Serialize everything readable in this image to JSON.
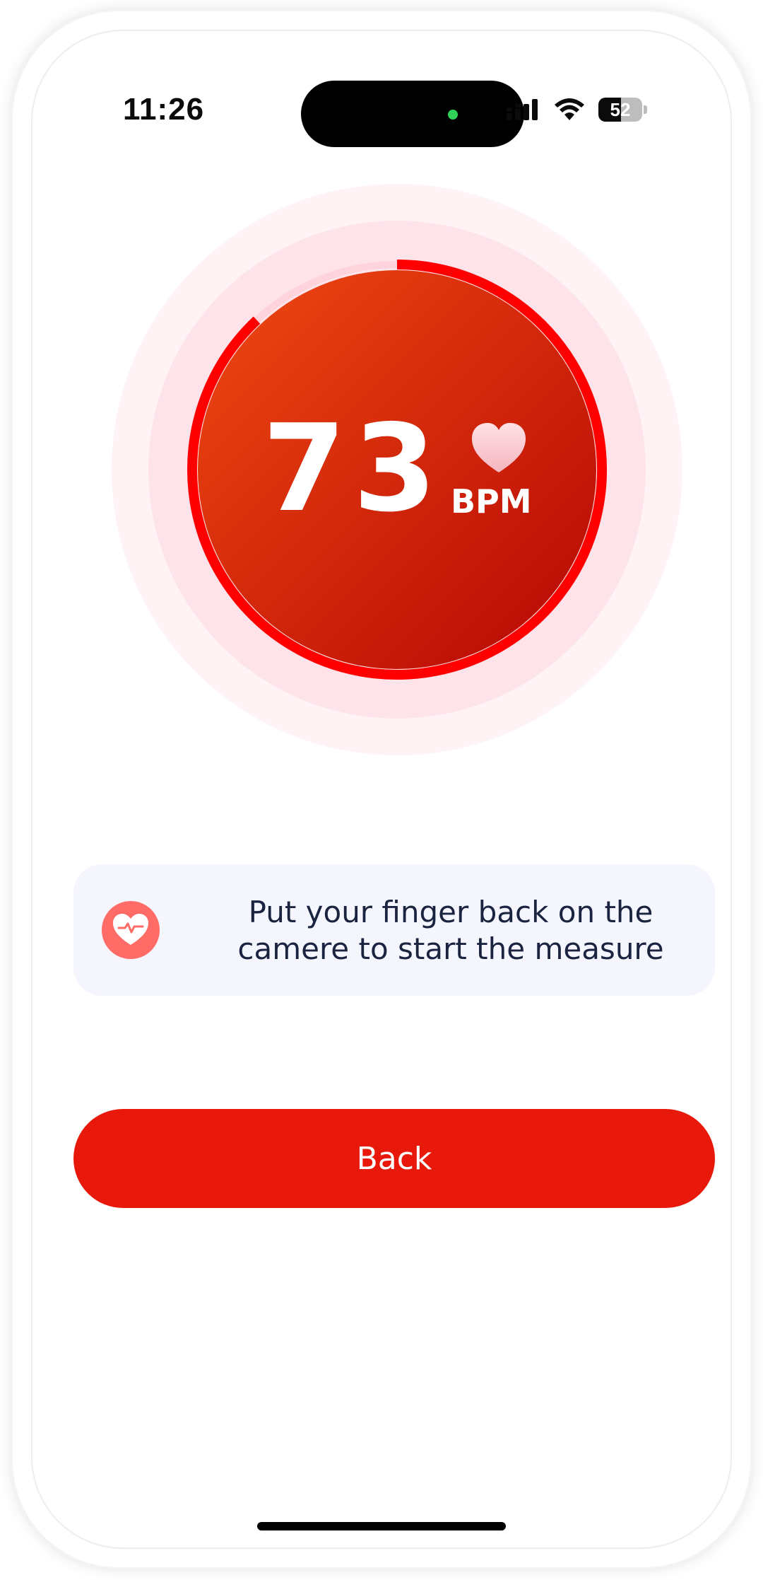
{
  "status_bar": {
    "time": "11:26",
    "battery_percent": "52",
    "battery_level": 0.52
  },
  "measurement": {
    "value": "73",
    "unit": "BPM",
    "progress": 0.88
  },
  "info": {
    "message": "Put your finger back on the camere to start the measure"
  },
  "actions": {
    "back_label": "Back"
  },
  "colors": {
    "accent": "#e8190a",
    "ring": "#ff0000",
    "info_icon_bg": "#ff6b66",
    "card_bg": "#f5f6fd"
  },
  "icons": {
    "signal": "cellular-signal-icon",
    "wifi": "wifi-icon",
    "battery": "battery-icon",
    "heart": "heart-icon",
    "info": "heart-pulse-icon"
  }
}
